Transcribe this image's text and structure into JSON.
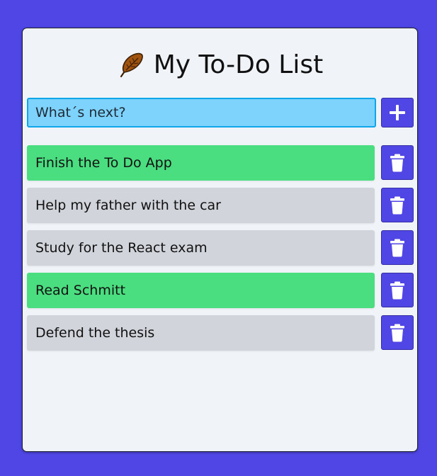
{
  "header": {
    "title": "My To-Do List",
    "icon": "feather-icon"
  },
  "input": {
    "placeholder": "What´s next?",
    "value": ""
  },
  "buttons": {
    "add_icon": "plus-icon",
    "delete_icon": "trash-icon"
  },
  "todos": [
    {
      "text": "Finish the To Do App",
      "completed": true
    },
    {
      "text": "Help my father with the car",
      "completed": false
    },
    {
      "text": "Study for the React exam",
      "completed": false
    },
    {
      "text": "Read Schmitt",
      "completed": true
    },
    {
      "text": "Defend the thesis",
      "completed": false
    }
  ],
  "colors": {
    "background": "#4f46e5",
    "card": "#f0f4f8",
    "input": "#7dd3fc",
    "done": "#4ade80",
    "pending": "#d1d5db",
    "button": "#4f46e5",
    "feather": "#a0520f"
  }
}
